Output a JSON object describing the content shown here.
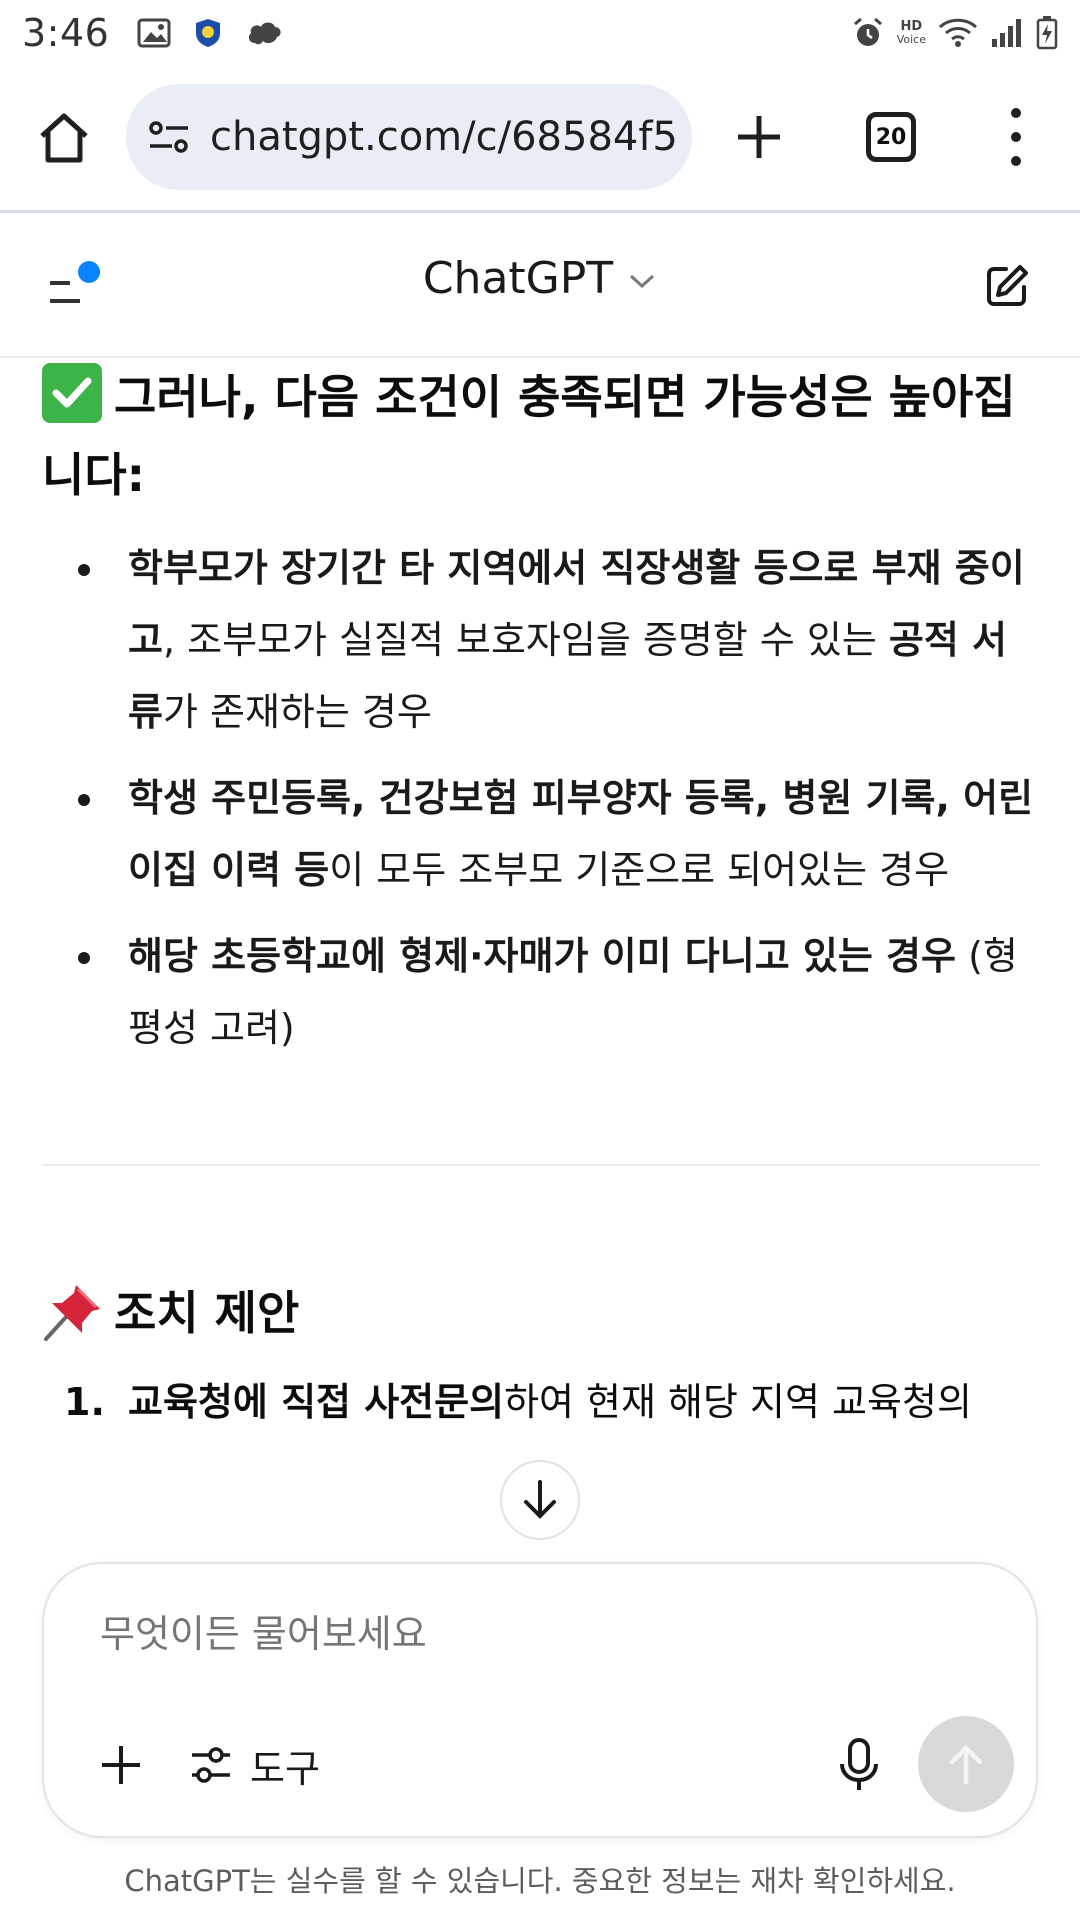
{
  "status": {
    "time": "3:46",
    "hd_label": "HD",
    "voice_label": "Voice"
  },
  "browser": {
    "url": "chatgpt.com/c/68584f5",
    "tab_count": "20"
  },
  "header": {
    "title": "ChatGPT"
  },
  "content": {
    "heading1": "그러나, 다음 조건이 충족되면 가능성은 높아집니다:",
    "bullets": [
      {
        "b1": "학부모가 장기간 타 지역에서 직장생활 등으로 부재 중이고",
        "t1": ", 조부모가 실질적 보호자임을 증명할 수 있는 ",
        "b2": "공적 서류",
        "t2": "가 존재하는 경우"
      },
      {
        "b1": "학생 주민등록, 건강보험 피부양자 등록, 병원 기록, 어린이집 이력 등",
        "t1": "이 모두 조부모 기준으로 되어있는 경우"
      },
      {
        "b1": "해당 초등학교에 형제·자매가 이미 다니고 있는 경우",
        "t1": " (형평성 고려)"
      }
    ],
    "heading2": "조치 제안",
    "ol_items": [
      {
        "num": "1.",
        "bold": "교육청에 직접 사전문의",
        "text": "하여 현재 해당 지역 교육청의"
      }
    ]
  },
  "composer": {
    "placeholder": "무엇이든 물어보세요",
    "tools_label": "도구"
  },
  "disclaimer": "ChatGPT는 실수를 할 수 있습니다. 중요한 정보는 재차 확인하세요.",
  "colors": {
    "accent_dot": "#0a84ff",
    "url_bg": "#e9eef6",
    "check_green": "#3db44a",
    "send_disabled": "#d9d9d9"
  }
}
